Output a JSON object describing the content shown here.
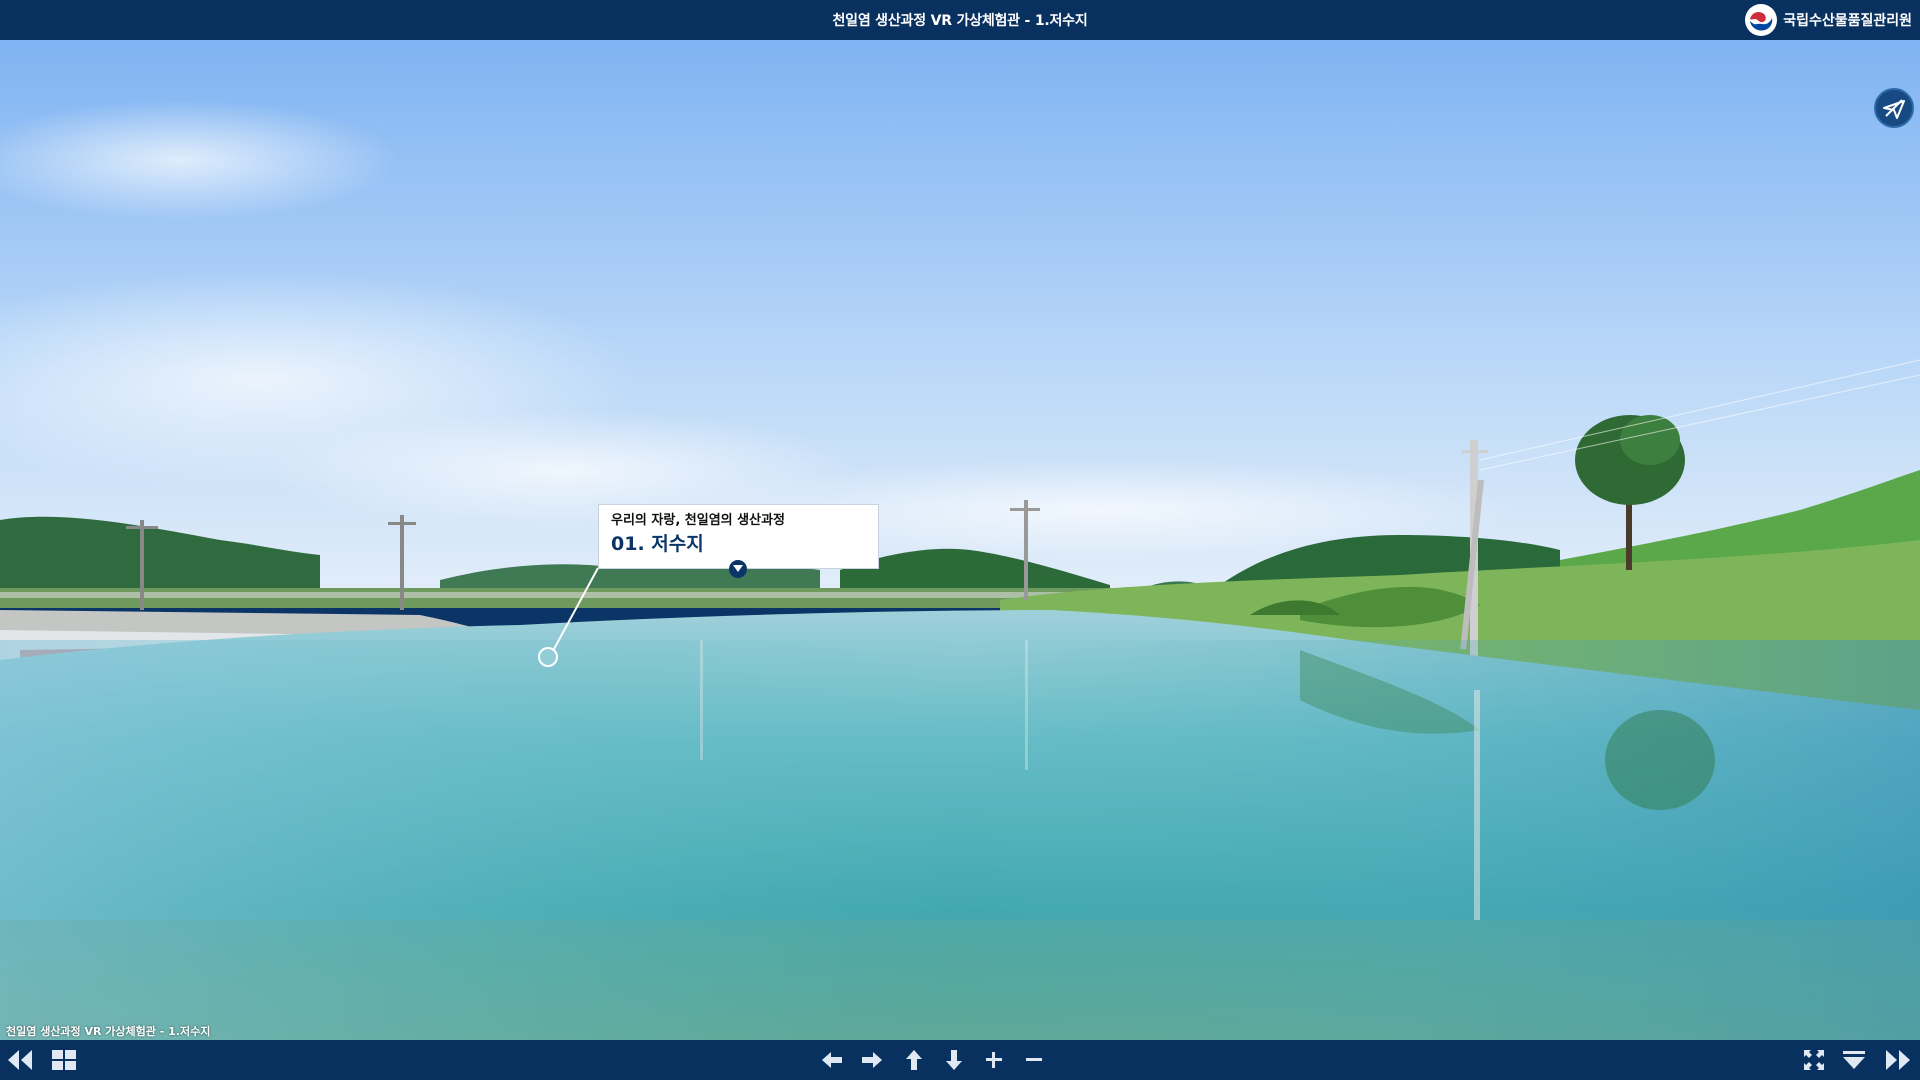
{
  "header": {
    "title": "천일염 생산과정 VR 가상체험관 - 1.저수지",
    "org_name": "국립수산물품질관리원",
    "logo_icon": "government-emblem-icon"
  },
  "hotspot": {
    "subtitle": "우리의 자랑, 천일염의 생산과정",
    "title": "01. 저수지"
  },
  "caption": "천일염 생산과정 VR 가상체험관 - 1.저수지",
  "controls": {
    "left": [
      {
        "name": "previous-scene-icon"
      },
      {
        "name": "thumbnails-grid-icon"
      }
    ],
    "center": [
      {
        "name": "arrow-left-icon"
      },
      {
        "name": "arrow-right-icon"
      },
      {
        "name": "arrow-up-icon"
      },
      {
        "name": "arrow-down-icon"
      },
      {
        "name": "zoom-in-icon"
      },
      {
        "name": "zoom-out-icon"
      }
    ],
    "right": [
      {
        "name": "fullscreen-icon"
      },
      {
        "name": "hide-controls-icon"
      },
      {
        "name": "next-scene-icon"
      }
    ]
  },
  "colors": {
    "bar": "#08315f",
    "accent": "#0b3566"
  }
}
